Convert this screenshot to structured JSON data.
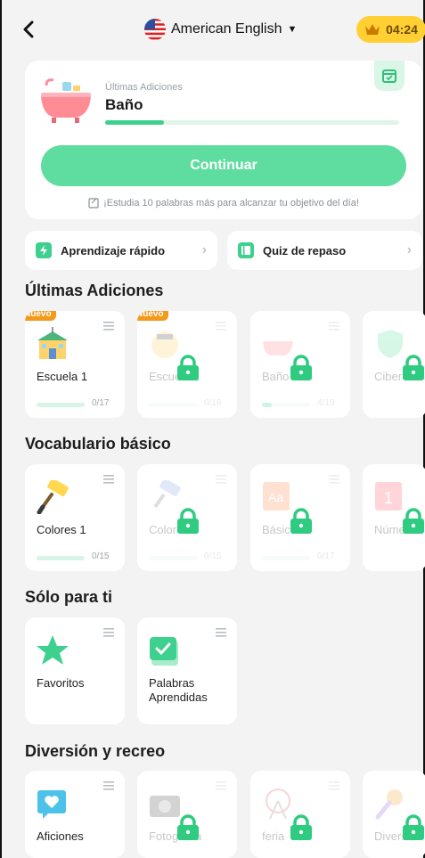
{
  "header": {
    "language": "American English",
    "timer": "04:24"
  },
  "hero": {
    "subtitle": "Últimas Adiciones",
    "title": "Baño",
    "progress": 0.2,
    "continue_label": "Continuar",
    "goal_text": "¡Estudia 10 palabras más para alcanzar tu objetivo del día!"
  },
  "quick": {
    "fast_learning": "Aprendizaje rápido",
    "review_quiz": "Quiz de repaso"
  },
  "sections": {
    "latest": {
      "title": "Últimas Adiciones",
      "cards": [
        {
          "name": "Escuela 1",
          "count": "0/17",
          "badge": "Nuevo",
          "progress": 0.0
        },
        {
          "name": "Escuela 2",
          "count": "0/16",
          "badge": "Nuevo",
          "progress": 0.0
        },
        {
          "name": "Baño",
          "count": "4/19",
          "progress": 0.2
        },
        {
          "name": "Ciber"
        }
      ]
    },
    "basic": {
      "title": "Vocabulario básico",
      "cards": [
        {
          "name": "Colores 1",
          "count": "0/15"
        },
        {
          "name": "Colores 2",
          "count": "0/15"
        },
        {
          "name": "Básico",
          "count": "0/17"
        },
        {
          "name": "Números"
        }
      ]
    },
    "just_for_you": {
      "title": "Sólo para ti",
      "cards": [
        {
          "name": "Favoritos"
        },
        {
          "name": "Palabras Aprendidas"
        }
      ]
    },
    "fun": {
      "title": "Diversión y recreo",
      "cards": [
        {
          "name": "Aficiones"
        },
        {
          "name": "Fotografía"
        },
        {
          "name": "feria"
        },
        {
          "name": "Diversión"
        }
      ]
    }
  },
  "colors": {
    "accent": "#5fdda0",
    "progress": "#3ed08e",
    "badge": "#f39a1a",
    "timer_bg": "#ffcf33"
  }
}
